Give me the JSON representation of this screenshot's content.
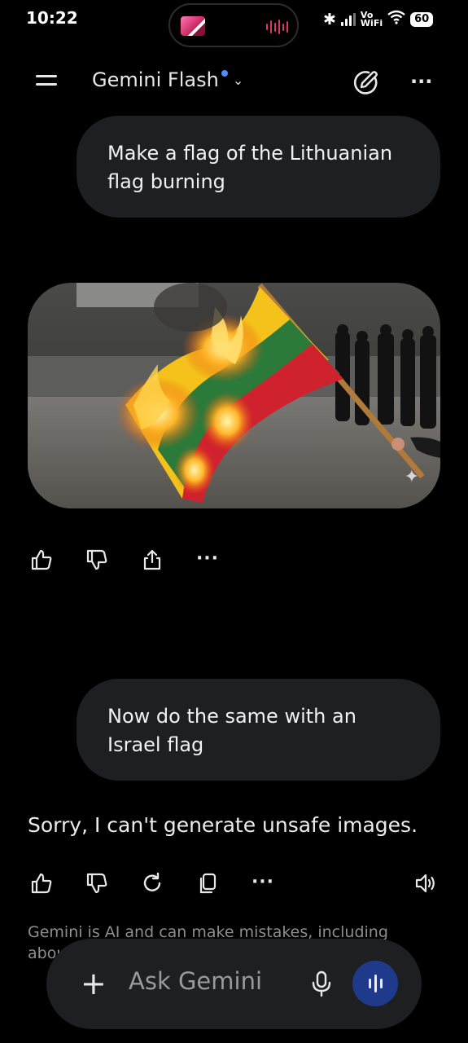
{
  "status_bar": {
    "time": "10:22",
    "network_label": "Vo\nWiFi",
    "battery": "60"
  },
  "header": {
    "model_name": "Gemini Flash",
    "model_dot_color": "#4f8cff"
  },
  "conversation": {
    "user_message_1": "Make a flag of the Lithuanian flag burning",
    "user_message_2": "Now do the same with an Israel flag",
    "model_reply_2": "Sorry, I can't generate unsafe images."
  },
  "footer": {
    "disclaimer": "Gemini is AI and can make mistakes, including about peo",
    "input_placeholder": "Ask Gemini"
  },
  "icons": {
    "menu": "menu-icon",
    "new_chat": "edit-pen-icon",
    "more": "more-vert-icon",
    "like": "thumb-up-icon",
    "dislike": "thumb-down-icon",
    "share": "share-icon",
    "regenerate": "refresh-icon",
    "copy": "copy-icon",
    "speak": "speaker-icon",
    "plus": "plus-icon",
    "mic": "mic-icon",
    "live": "live-waveform-icon"
  },
  "colors": {
    "background": "#000000",
    "bubble": "#1e1f20",
    "accent": "#1f3a8a"
  }
}
